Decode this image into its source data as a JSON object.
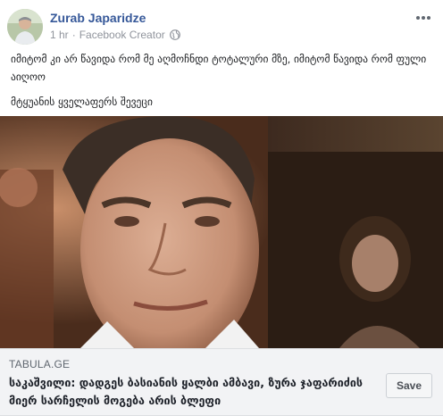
{
  "post": {
    "author": "Zurab Japaridze",
    "time": "1 hr",
    "separator": "·",
    "author_role": "Facebook Creator",
    "more_icon": "ellipsis-icon",
    "privacy_icon": "globe-icon",
    "text_lines": [
      "იმიტომ კი არ წავიდა რომ მე აღმოჩნდი ტოტალური მზე, იმიტომ წავიდა რომ ფული აიღოო",
      "მტყუანის ყველაფერს შევეცი"
    ]
  },
  "link_preview": {
    "domain": "TABULA.GE",
    "title": "საკაშვილი: დადგეს ბასიანის ყალბი ამბავი, ზურა ჯაფარიძის მიერ სარჩელის მოგება არის ბლეფი",
    "save_label": "Save"
  },
  "colors": {
    "author": "#365899",
    "meta": "#90949c",
    "link_bg": "#f2f3f5"
  }
}
